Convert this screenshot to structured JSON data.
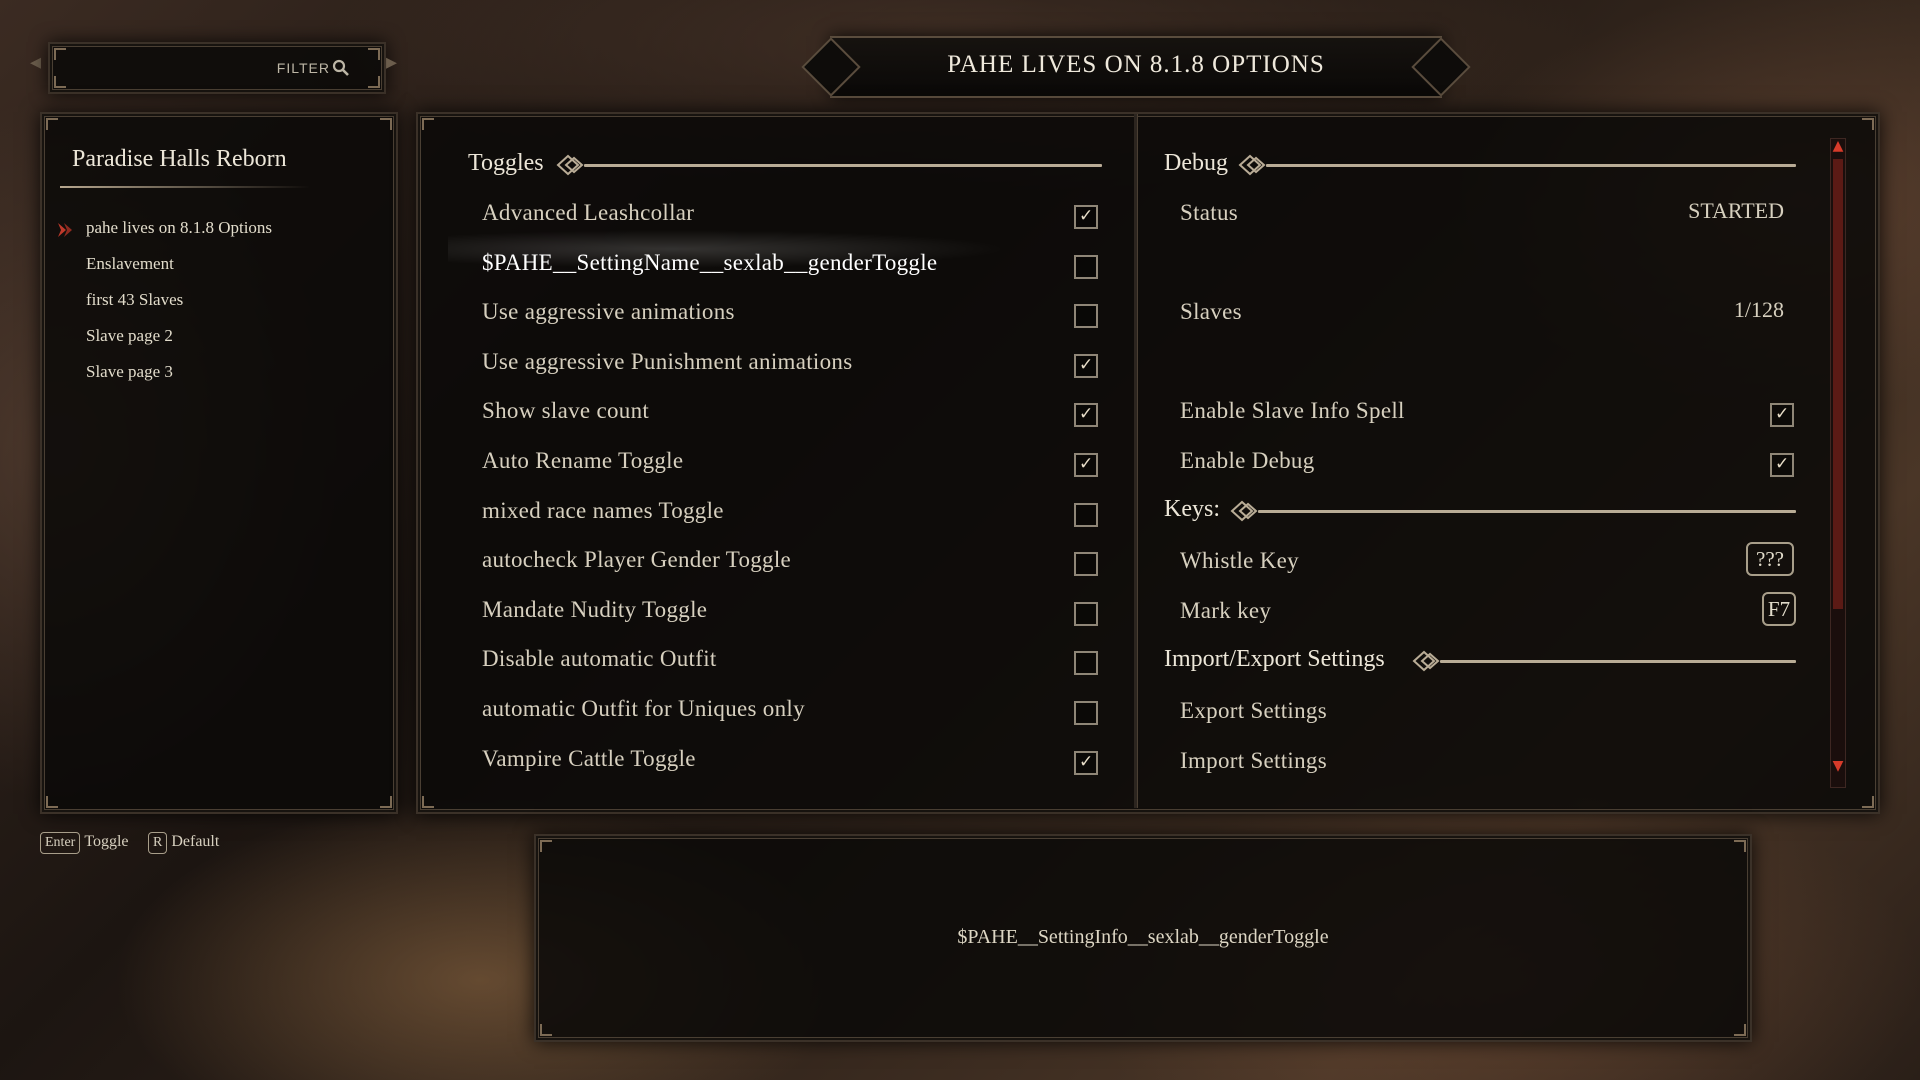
{
  "filter": {
    "label": "FILTER"
  },
  "title": "PAHE LIVES ON 8.1.8 OPTIONS",
  "mod_list": {
    "mod_name": "Paradise Halls Reborn",
    "pages": [
      "pahe lives on 8.1.8 Options",
      "Enslavement",
      "first 43 Slaves",
      "Slave page 2",
      "Slave page 3"
    ],
    "selected": "pahe lives on 8.1.8 Options"
  },
  "left_column": {
    "header": "Toggles",
    "options": [
      {
        "label": "Advanced Leashcollar",
        "checked": true
      },
      {
        "label": "$PAHE__SettingName__sexlab__genderToggle",
        "checked": false
      },
      {
        "label": "Use aggressive animations",
        "checked": false
      },
      {
        "label": "Use aggressive Punishment animations",
        "checked": true
      },
      {
        "label": "Show slave count",
        "checked": true
      },
      {
        "label": "Auto Rename Toggle",
        "checked": true
      },
      {
        "label": "mixed race names Toggle",
        "checked": false
      },
      {
        "label": "autocheck Player Gender Toggle",
        "checked": false
      },
      {
        "label": "Mandate Nudity Toggle",
        "checked": false
      },
      {
        "label": "Disable automatic Outfit",
        "checked": false
      },
      {
        "label": "automatic Outfit for Uniques only",
        "checked": false
      },
      {
        "label": "Vampire Cattle Toggle",
        "checked": true
      }
    ]
  },
  "right_column": {
    "debug_header": "Debug",
    "status_label": "Status",
    "status_value": "STARTED",
    "slaves_label": "Slaves",
    "slaves_value": "1/128",
    "enable_info_spell_label": "Enable Slave Info Spell",
    "enable_info_spell_checked": true,
    "enable_debug_label": "Enable Debug",
    "enable_debug_checked": true,
    "keys_header": "Keys:",
    "whistle_key_label": "Whistle Key",
    "whistle_key_value": "???",
    "mark_key_label": "Mark key",
    "mark_key_value": "F7",
    "import_export_header": "Import/Export Settings",
    "export_label": "Export Settings",
    "import_label": "Import Settings"
  },
  "hints": {
    "enter_key": "Enter",
    "enter_action": "Toggle",
    "r_key": "R",
    "r_action": "Default"
  },
  "info_text": "$PAHE__SettingInfo__sexlab__genderToggle",
  "colors": {
    "accent": "#c0392b",
    "text": "#e2dccb",
    "line": "#b9ac96"
  }
}
